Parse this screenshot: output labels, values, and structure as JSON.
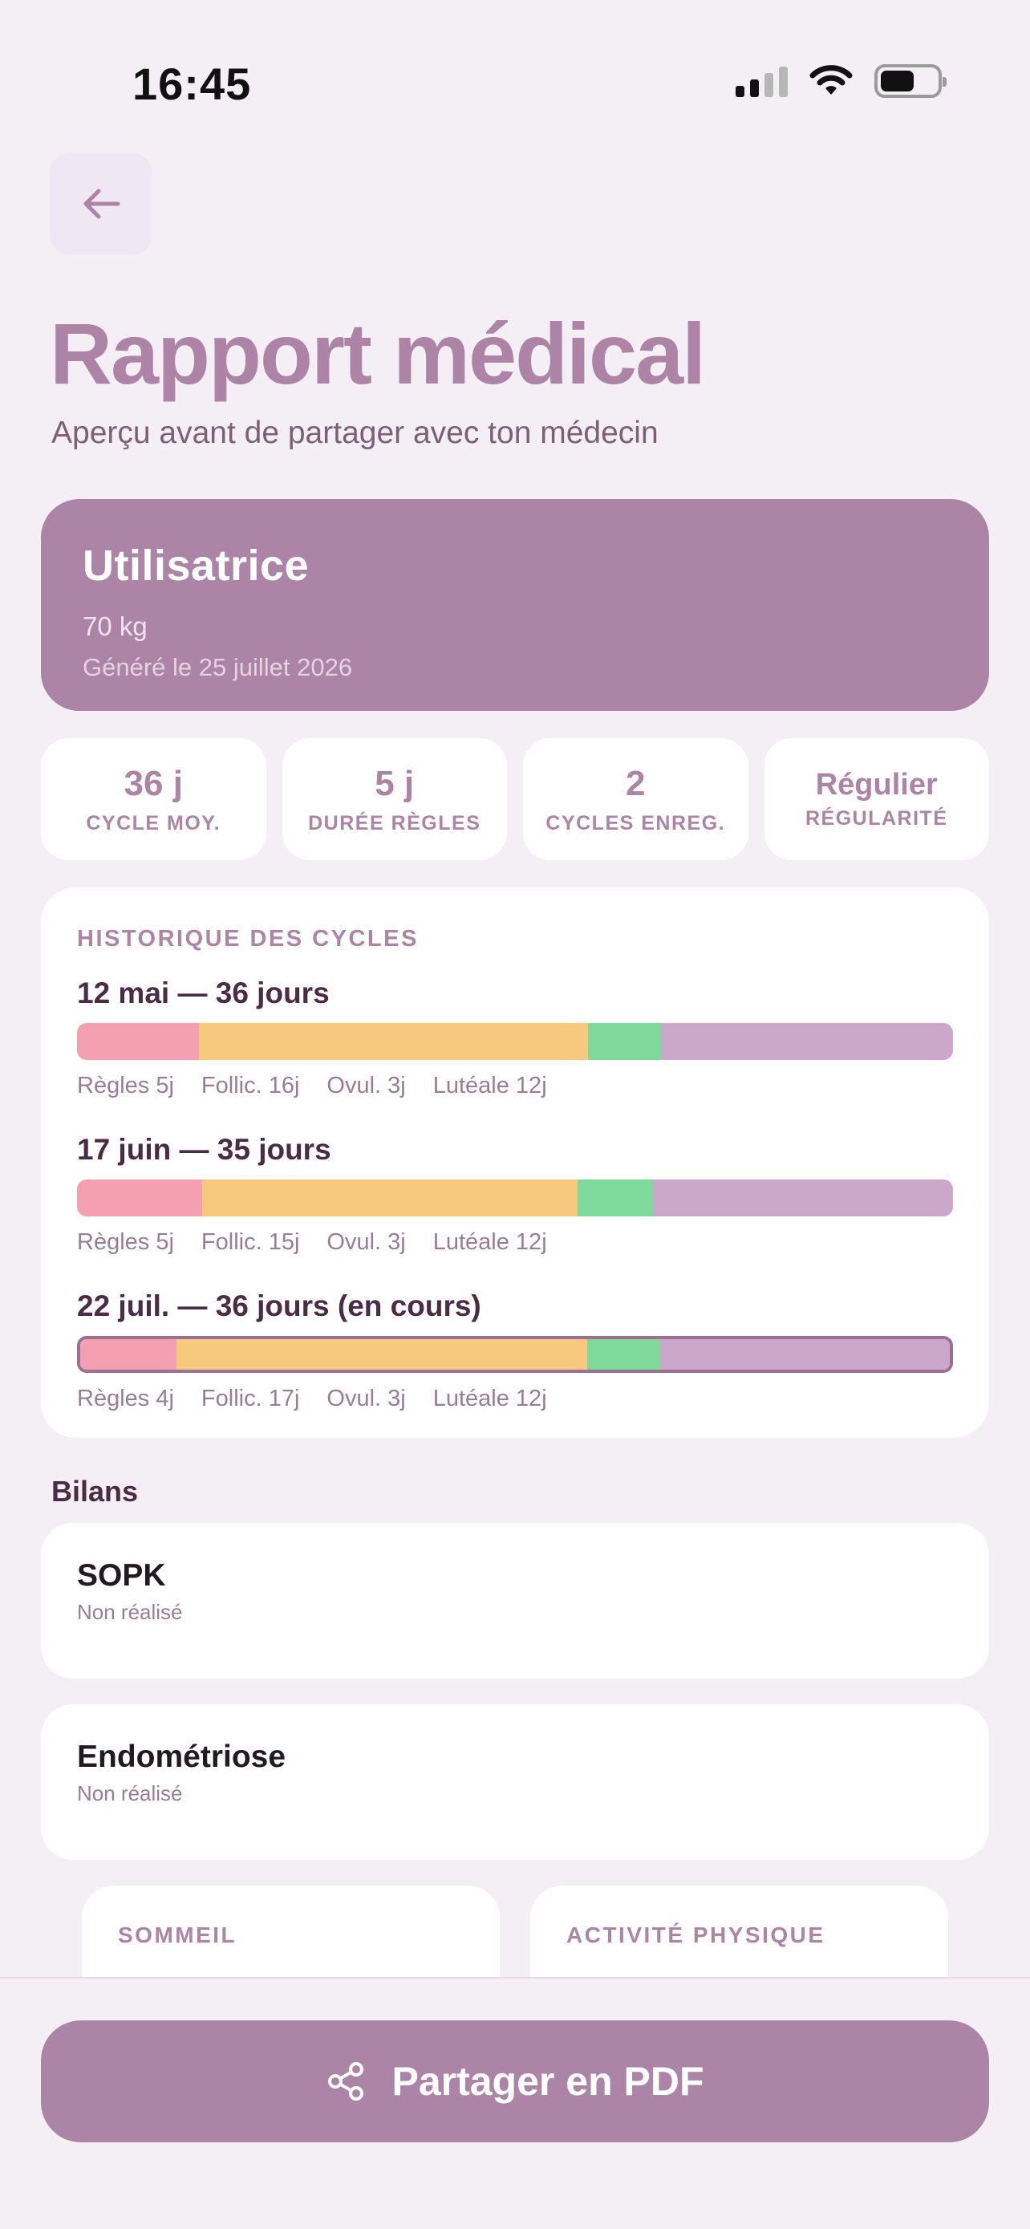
{
  "status_bar": {
    "time": "16:45"
  },
  "header": {
    "title": "Rapport médical",
    "subtitle": "Aperçu avant de partager avec ton médecin"
  },
  "user": {
    "name": "Utilisatrice",
    "weight": "70 kg",
    "generated": "Généré le 25 juillet 2026"
  },
  "stats": [
    {
      "value": "36 j",
      "label": "CYCLE MOY."
    },
    {
      "value": "5 j",
      "label": "DURÉE RÈGLES"
    },
    {
      "value": "2",
      "label": "CYCLES ENREG."
    },
    {
      "value": "Régulier",
      "label": "RÉGULARITÉ"
    }
  ],
  "history": {
    "kicker": "HISTORIQUE DES CYCLES",
    "cycles": [
      {
        "title": "12 mai — 36 jours",
        "current": false,
        "phases": [
          {
            "label": "Règles 5j",
            "days": 5
          },
          {
            "label": "Follic. 16j",
            "days": 16
          },
          {
            "label": "Ovul. 3j",
            "days": 3
          },
          {
            "label": "Lutéale 12j",
            "days": 12
          }
        ]
      },
      {
        "title": "17 juin — 35 jours",
        "current": false,
        "phases": [
          {
            "label": "Règles 5j",
            "days": 5
          },
          {
            "label": "Follic. 15j",
            "days": 15
          },
          {
            "label": "Ovul. 3j",
            "days": 3
          },
          {
            "label": "Lutéale 12j",
            "days": 12
          }
        ]
      },
      {
        "title": "22 juil. — 36 jours (en cours)",
        "current": true,
        "phases": [
          {
            "label": "Règles 4j",
            "days": 4
          },
          {
            "label": "Follic. 17j",
            "days": 17
          },
          {
            "label": "Ovul. 3j",
            "days": 3
          },
          {
            "label": "Lutéale 12j",
            "days": 12
          }
        ]
      }
    ]
  },
  "bilans": {
    "title": "Bilans",
    "items": [
      {
        "name": "SOPK",
        "status": "Non réalisé"
      },
      {
        "name": "Endométriose",
        "status": "Non réalisé"
      }
    ]
  },
  "mini_cards": [
    "SOMMEIL",
    "ACTIVITÉ PHYSIQUE"
  ],
  "share_button": {
    "label": "Partager en PDF"
  },
  "colors": {
    "accent": "#ac84a6",
    "regles": "#f3a1b1",
    "follic": "#f7c97e",
    "ovul": "#7fd99a",
    "luteale": "#cba7cb"
  }
}
